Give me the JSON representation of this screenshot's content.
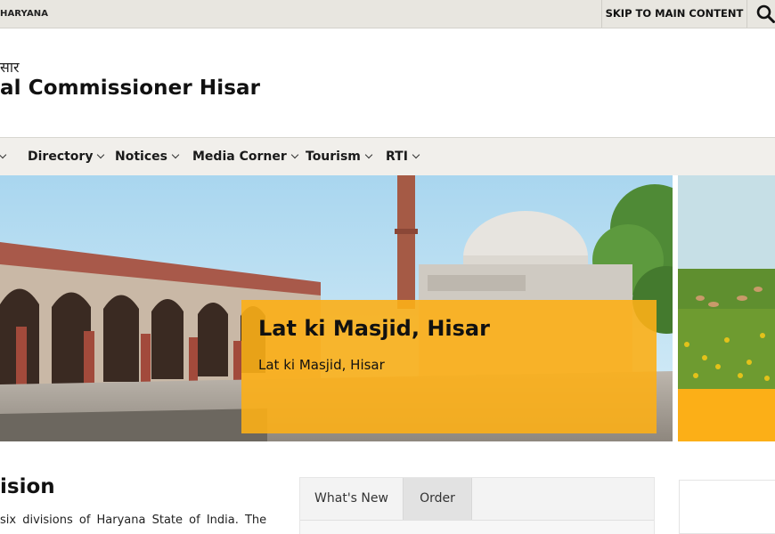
{
  "topbar": {
    "gov_label": "HARYANA",
    "skip_label": "SKIP TO MAIN CONTENT",
    "search_icon": "search-icon"
  },
  "header": {
    "hindi_title": "सार",
    "title": "al Commissioner Hisar"
  },
  "nav": {
    "items": [
      {
        "label": ""
      },
      {
        "label": "Directory"
      },
      {
        "label": "Notices"
      },
      {
        "label": "Media Corner"
      },
      {
        "label": "Tourism"
      },
      {
        "label": "RTI"
      }
    ]
  },
  "banner": {
    "caption_title": "Lat ki Masjid, Hisar",
    "caption_subtitle": "Lat ki Masjid, Hisar",
    "caption_color": "#fcaf17"
  },
  "main": {
    "division_heading": "ision",
    "division_text": "six divisions of Haryana State of India. The"
  },
  "tabs": {
    "items": [
      {
        "label": "What's New"
      },
      {
        "label": "Order"
      }
    ]
  },
  "colors": {
    "accent": "#fcaf17",
    "topbar_bg": "#e8e6e0",
    "nav_bg": "#f1efeb"
  }
}
